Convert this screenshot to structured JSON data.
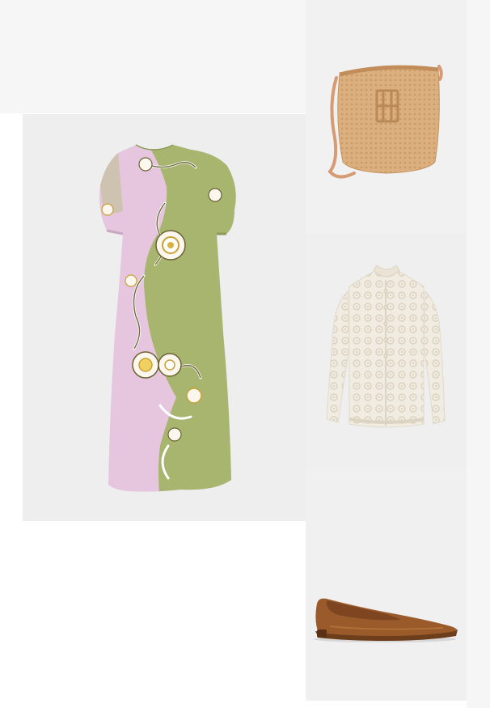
{
  "outfit": {
    "products": [
      {
        "item": "dress",
        "icon": "floral-maxi-dress-icon"
      },
      {
        "item": "bag",
        "icon": "straw-bucket-bag-icon"
      },
      {
        "item": "cardigan",
        "icon": "crochet-cardigan-icon"
      },
      {
        "item": "shoes",
        "icon": "ballet-flat-icon"
      }
    ],
    "colors": {
      "dress_pink": "#e6c6de",
      "dress_green": "#a8b56f",
      "bag_straw": "#dcb07e",
      "cardigan_cream": "#f1ece1",
      "flats_brown": "#9a5a2a"
    }
  }
}
